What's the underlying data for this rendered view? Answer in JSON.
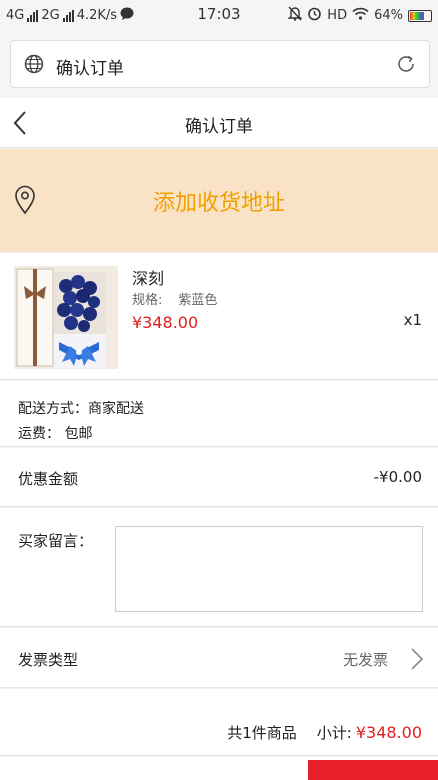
{
  "status_bar": {
    "network1": "4G",
    "network2": "2G",
    "speed": "4.2K/s",
    "time": "17:03",
    "hd": "HD",
    "battery": "64%",
    "battery_level": 0.64
  },
  "browser": {
    "title": "确认订单"
  },
  "nav": {
    "title": "确认订单"
  },
  "address": {
    "add_label": "添加收货地址"
  },
  "product": {
    "name": "深刻",
    "spec_label": "规格:",
    "spec_value": "紫蓝色",
    "price": "¥348.00",
    "quantity": "x1"
  },
  "delivery": {
    "method": "配送方式：商家配送",
    "fee": "运费：  包邮"
  },
  "discount": {
    "label": "优惠金额",
    "value": "-¥0.00"
  },
  "message": {
    "label": "买家留言：",
    "value": ""
  },
  "invoice": {
    "label": "发票类型",
    "value": "无发票"
  },
  "summary": {
    "count": "共1件商品",
    "subtotal_label": "小计:",
    "subtotal": "¥348.00"
  },
  "colors": {
    "accent": "#f0a000",
    "price": "#e02020",
    "address_bg": "#f9e2c5",
    "submit": "#e8202a"
  }
}
